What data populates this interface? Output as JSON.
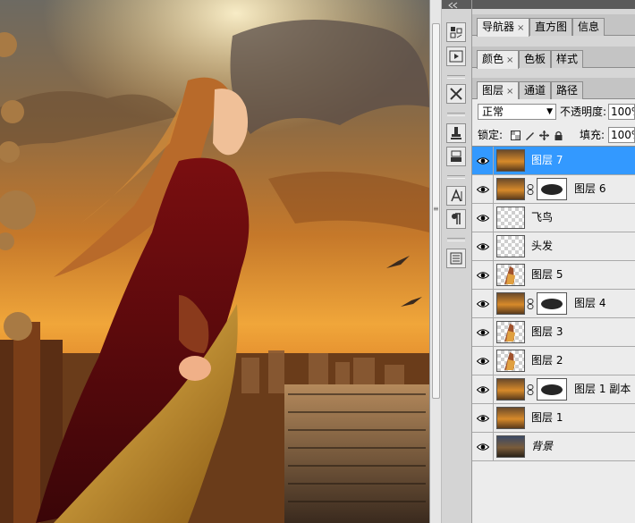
{
  "panels": {
    "group1_tabs": [
      {
        "label": "导航器",
        "closable": true
      },
      {
        "label": "直方图",
        "closable": false
      },
      {
        "label": "信息",
        "closable": false
      }
    ],
    "group2_tabs": [
      {
        "label": "颜色",
        "closable": true
      },
      {
        "label": "色板",
        "closable": false
      },
      {
        "label": "样式",
        "closable": false
      }
    ],
    "group3_tabs": [
      {
        "label": "图层",
        "closable": true
      },
      {
        "label": "通道",
        "closable": false
      },
      {
        "label": "路径",
        "closable": false
      }
    ],
    "close_glyph": "×"
  },
  "layers_options": {
    "blend_mode": "正常",
    "opacity_label": "不透明度:",
    "opacity_value": "100%",
    "lock_label": "锁定:",
    "fill_label": "填充:",
    "fill_value": "100%"
  },
  "layers": [
    {
      "name": "图层 7",
      "selected": true,
      "thumb": "scene",
      "mask": false
    },
    {
      "name": "图层 6",
      "selected": false,
      "thumb": "scene",
      "mask": true
    },
    {
      "name": "飞鸟",
      "selected": false,
      "thumb": "checker",
      "mask": false
    },
    {
      "name": "头发",
      "selected": false,
      "thumb": "checker",
      "mask": false
    },
    {
      "name": "图层 5",
      "selected": false,
      "thumb": "figure",
      "mask": false
    },
    {
      "name": "图层 4",
      "selected": false,
      "thumb": "scene",
      "mask": true
    },
    {
      "name": "图层 3",
      "selected": false,
      "thumb": "figure",
      "mask": false
    },
    {
      "name": "图层 2",
      "selected": false,
      "thumb": "figure",
      "mask": false
    },
    {
      "name": "图层 1 副本",
      "selected": false,
      "thumb": "scene",
      "mask": true
    },
    {
      "name": "图层 1",
      "selected": false,
      "thumb": "scene",
      "mask": false
    },
    {
      "name": "背景",
      "selected": false,
      "thumb": "scene-dark",
      "mask": false,
      "italic": true
    }
  ],
  "colors": {
    "selection": "#3399ff",
    "panel_bg": "#ececec",
    "panel_header": "#5a5a5a"
  },
  "icons": {
    "tools": [
      "histogram-icon",
      "play-icon",
      "brush-tools-icon",
      "clone-stamp-icon",
      "history-brush-icon",
      "type-icon",
      "paragraph-icon",
      "notes-icon"
    ],
    "lock": [
      "lock-transparent-icon",
      "lock-image-icon",
      "lock-position-icon",
      "lock-all-icon"
    ],
    "layer_row": [
      "eye-icon",
      "link-chain-icon"
    ]
  }
}
